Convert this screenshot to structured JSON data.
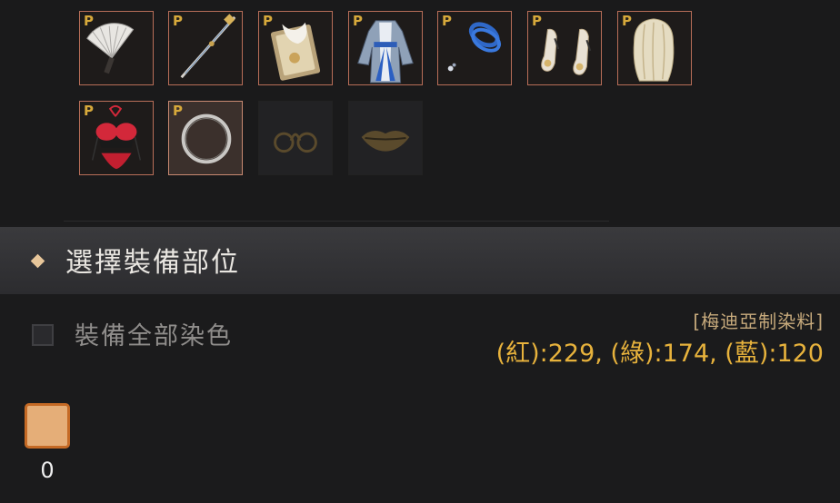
{
  "slots": [
    {
      "p_label": "P",
      "icon": "fan-icon"
    },
    {
      "p_label": "P",
      "icon": "spear-icon"
    },
    {
      "p_label": "P",
      "icon": "ornate-card-icon"
    },
    {
      "p_label": "P",
      "icon": "blue-robe-icon"
    },
    {
      "p_label": "P",
      "icon": "blue-bracelet-icon"
    },
    {
      "p_label": "P",
      "icon": "high-heels-icon"
    },
    {
      "p_label": "P",
      "icon": "blonde-hair-icon"
    },
    {
      "p_label": "P",
      "icon": "red-lingerie-icon"
    },
    {
      "p_label": "P",
      "icon": "silver-ring-icon"
    },
    {
      "icon": "glasses-placeholder-icon"
    },
    {
      "icon": "lips-placeholder-icon"
    }
  ],
  "section": {
    "title": "選擇裝備部位"
  },
  "dye_all": {
    "label": "裝備全部染色",
    "checked": false
  },
  "dye": {
    "name": "[梅迪亞制染料]",
    "values": "(紅):229, (綠):174, (藍):120",
    "color": "#e5ae78",
    "count": "0"
  }
}
